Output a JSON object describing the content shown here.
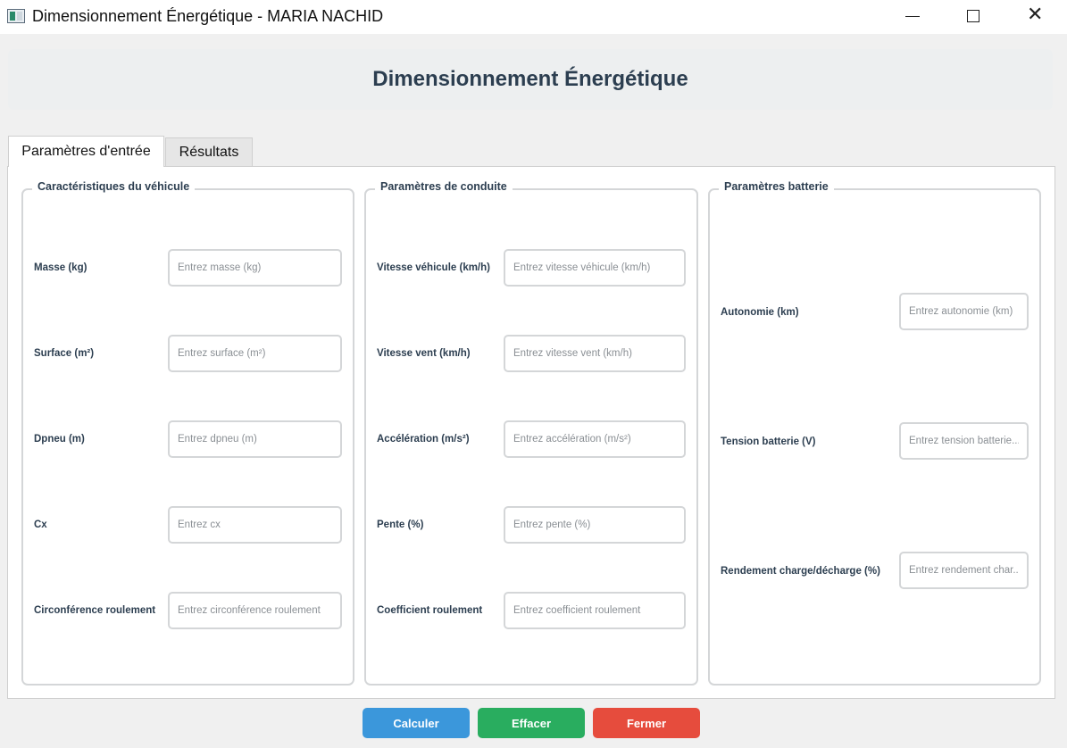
{
  "window": {
    "title": "Dimensionnement Énergétique - MARIA NACHID"
  },
  "header": {
    "title": "Dimensionnement Énergétique"
  },
  "tabs": [
    {
      "label": "Paramètres d'entrée",
      "active": true
    },
    {
      "label": "Résultats",
      "active": false
    }
  ],
  "groups": {
    "vehicle": {
      "title": "Caractéristiques du véhicule",
      "fields": [
        {
          "label": "Masse (kg)",
          "value": "",
          "placeholder": "Entrez masse (kg)"
        },
        {
          "label": "Surface (m²)",
          "value": "",
          "placeholder": "Entrez surface (m²)"
        },
        {
          "label": "Dpneu (m)",
          "value": "",
          "placeholder": "Entrez dpneu (m)"
        },
        {
          "label": "Cx",
          "value": "",
          "placeholder": "Entrez cx"
        },
        {
          "label": "Circonférence roulement",
          "value": "",
          "placeholder": "Entrez circonférence roulement"
        }
      ]
    },
    "driving": {
      "title": "Paramètres de conduite",
      "fields": [
        {
          "label": "Vitesse véhicule (km/h)",
          "value": "",
          "placeholder": "Entrez vitesse véhicule (km/h)"
        },
        {
          "label": "Vitesse vent (km/h)",
          "value": "",
          "placeholder": "Entrez vitesse vent (km/h)"
        },
        {
          "label": "Accélération (m/s²)",
          "value": "",
          "placeholder": "Entrez accélération (m/s²)"
        },
        {
          "label": "Pente (%)",
          "value": "",
          "placeholder": "Entrez pente (%)"
        },
        {
          "label": "Coefficient roulement",
          "value": "",
          "placeholder": "Entrez coefficient roulement"
        }
      ]
    },
    "battery": {
      "title": "Paramètres batterie",
      "fields": [
        {
          "label": "Autonomie (km)",
          "value": "",
          "placeholder": "Entrez autonomie (km)"
        },
        {
          "label": "Tension batterie (V)",
          "value": "",
          "placeholder": "Entrez tension batterie..."
        },
        {
          "label": "Rendement charge/décharge (%)",
          "value": "",
          "placeholder": "Entrez rendement char..."
        }
      ]
    }
  },
  "buttons": {
    "calculate": "Calculer",
    "clear": "Effacer",
    "close": "Fermer"
  },
  "colors": {
    "calculate": "#3b97db",
    "clear": "#29ad5f",
    "close": "#e64c3d",
    "heading": "#2c3e50"
  }
}
